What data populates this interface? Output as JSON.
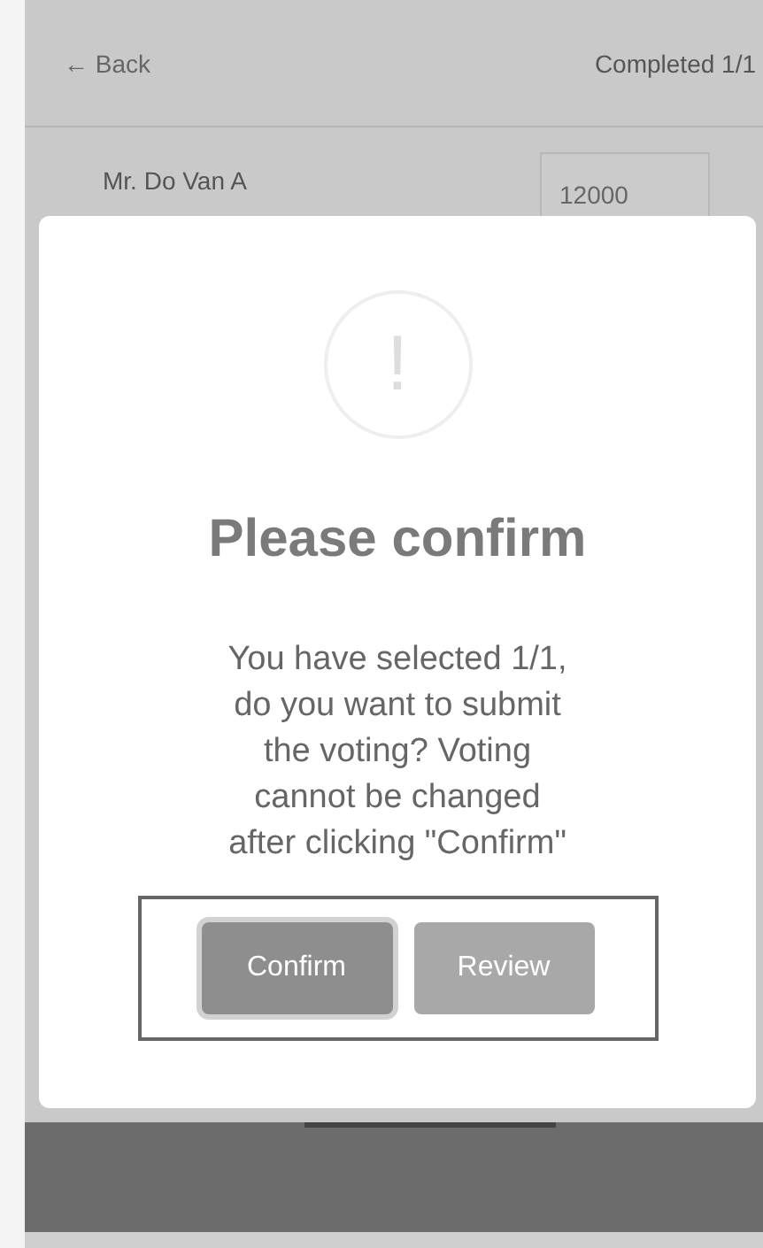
{
  "header": {
    "back": "← Back",
    "status": "Completed 1/1"
  },
  "row": {
    "name": "Mr. Do Van A",
    "value": "12000"
  },
  "dialog": {
    "icon": "!",
    "title": "Please confirm",
    "message": "You have selected 1/1, do you want to submit the voting? Voting cannot be changed after clicking \"Confirm\"",
    "buttons": [
      {
        "label": "Confirm",
        "selected": true
      },
      {
        "label": "Review",
        "selected": false
      }
    ]
  }
}
